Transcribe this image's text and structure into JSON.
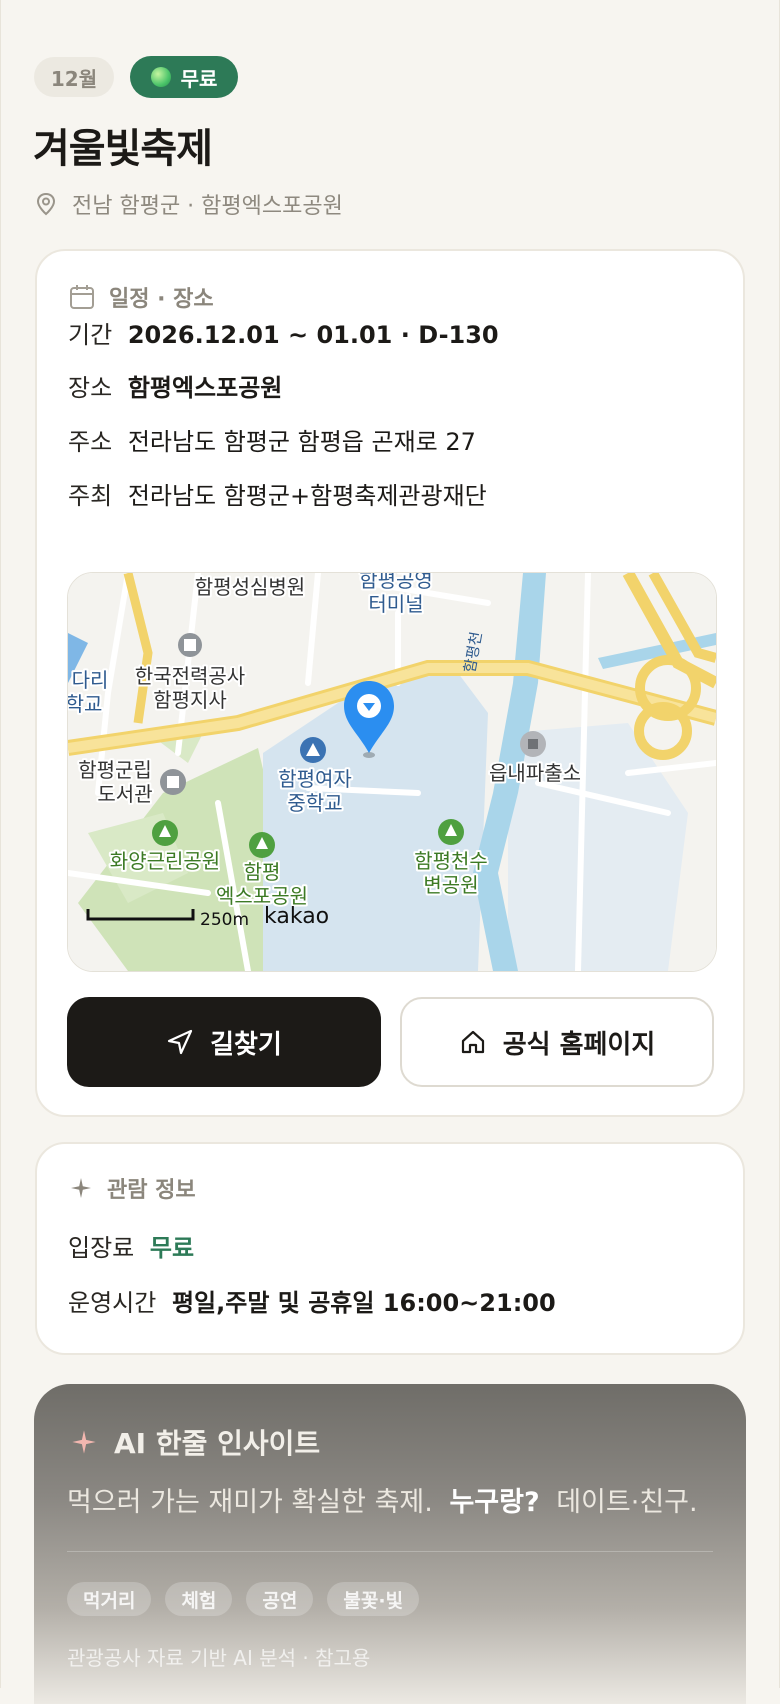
{
  "header": {
    "month_badge": "12월",
    "price_badge": "무료",
    "title": "겨울빛축제",
    "location": "전남 함평군 · 함평엑스포공원"
  },
  "schedule": {
    "heading": "일정 · 장소",
    "period_label": "기간",
    "period_value": "2026.12.01 ~ 01.01 · D-130",
    "venue_label": "장소",
    "venue_value": "함평엑스포공원",
    "address_label": "주소",
    "address_value": "전라남도 함평군 함평읍 곤재로 27",
    "host_label": "주최",
    "host_value": "전라남도 함평군+함평축제관광재단"
  },
  "map": {
    "labels": {
      "hospital": "함평성심병원",
      "terminal_1": "함평공영",
      "terminal_2": "터미널",
      "kepco_1": "한국전력공사",
      "kepco_2": "함평지사",
      "bridge_1": "다리",
      "bridge_2": "학교",
      "library_1": "함평군립",
      "library_2": "도서관",
      "girls_school_1": "함평여자",
      "girls_school_2": "중학교",
      "police": "읍내파출소",
      "river": "함평천",
      "park_a": "화양근린공원",
      "park_b_1": "함평",
      "park_b_2": "엑스포공원",
      "park_c_1": "함평천수",
      "park_c_2": "변공원",
      "scale": "250m",
      "provider": "kakao"
    }
  },
  "buttons": {
    "directions": "길찾기",
    "homepage": "공식 홈페이지"
  },
  "visit": {
    "heading": "관람 정보",
    "fee_label": "입장료",
    "fee_value": "무료",
    "hours_label": "운영시간",
    "hours_value": "평일,주말 및 공휴일 16:00~21:00"
  },
  "ai": {
    "heading": "AI 한줄 인사이트",
    "text_1": "먹으러 가는 재미가 확실한 축제.",
    "text_bold": "누구랑?",
    "text_2": "데이트·친구.",
    "tags": [
      "먹거리",
      "체험",
      "공연",
      "불꽃·빛"
    ],
    "footnote": "관광공사 자료 기반 AI 분석 · 참고용"
  },
  "colors": {
    "accent_green": "#2d7a57",
    "dark_button": "#1c1a17",
    "pin_blue": "#2b8ef0",
    "background": "#f7f5f0"
  }
}
